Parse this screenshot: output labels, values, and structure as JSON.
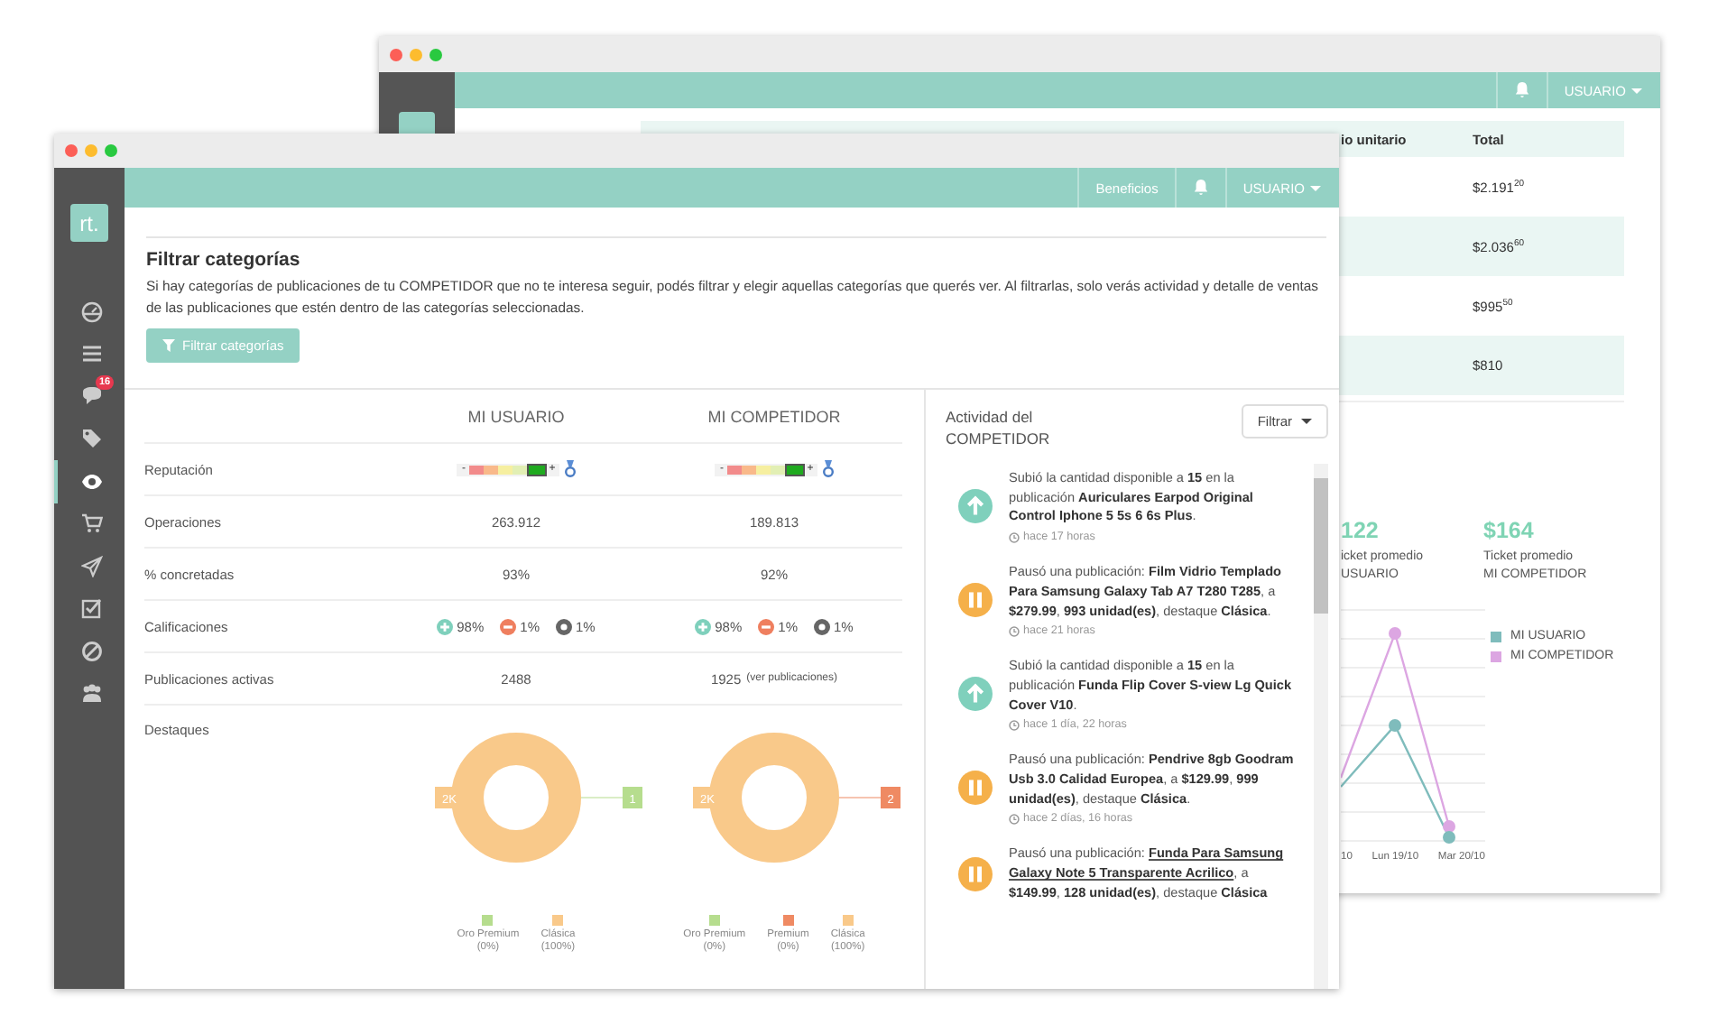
{
  "back_window": {
    "header": {
      "user_menu": "USUARIO"
    },
    "table": {
      "columns": [
        "io unitario",
        "Total"
      ],
      "rows": [
        {
          "total": "$2.191$^{20}$"
        },
        {
          "total": "$2.036$^{60}$"
        },
        {
          "total": "$995$^{50}$"
        },
        {
          "total": "$810"
        }
      ]
    },
    "stats": [
      {
        "value": "122",
        "label": "icket promedio",
        "owner": "USUARIO"
      },
      {
        "value": "$164",
        "label": "Ticket promedio",
        "owner": "MI COMPETIDOR"
      }
    ],
    "chart": {
      "x_labels": [
        "10",
        "Lun 19/10",
        "Mar 20/10"
      ],
      "legend": [
        {
          "label": "MI USUARIO",
          "color": "#7fbcbc"
        },
        {
          "label": "MI COMPETIDOR",
          "color": "#dca6e2"
        }
      ]
    }
  },
  "front_window": {
    "header": {
      "links": [
        "Beneficios"
      ],
      "user_menu": "USUARIO"
    },
    "sidebar": {
      "logo": "rt.",
      "items": [
        {
          "kind": "dashboard",
          "selected": false
        },
        {
          "kind": "list",
          "selected": false
        },
        {
          "kind": "chat",
          "selected": false,
          "badge": "16"
        },
        {
          "kind": "tags",
          "selected": false
        },
        {
          "kind": "eye",
          "selected": true
        },
        {
          "kind": "cart",
          "selected": false
        },
        {
          "kind": "send",
          "selected": false
        },
        {
          "kind": "check",
          "selected": false
        },
        {
          "kind": "ban",
          "selected": false
        },
        {
          "kind": "users",
          "selected": false
        }
      ]
    },
    "filter_section": {
      "title": "Filtrar categorías",
      "description": "Si hay categorías de publicaciones de tu COMPETIDOR que no te interesa seguir, podés filtrar y elegir aquellas categorías que querés ver. Al filtrarlas, solo verás actividad y detalle de ventas de las publicaciones que estén dentro de las categorías seleccionadas.",
      "button": "Filtrar categorías"
    },
    "comparison": {
      "columns": [
        "MI USUARIO",
        "MI COMPETIDOR"
      ],
      "rows": [
        {
          "kind": "reputation",
          "label": "Reputación",
          "values": [
            {
              "min": "-",
              "max": "+",
              "segments": [
                {
                  "color": "#f28b8b",
                  "selected": false
                },
                {
                  "color": "#f9b98a",
                  "selected": false
                },
                {
                  "color": "#f6efa0",
                  "selected": false
                },
                {
                  "color": "#e2efb4",
                  "selected": false
                },
                {
                  "color": "#1faa1f",
                  "selected": true
                }
              ]
            },
            {
              "min": "-",
              "max": "+",
              "segments": [
                {
                  "color": "#f28b8b",
                  "selected": false
                },
                {
                  "color": "#f9b98a",
                  "selected": false
                },
                {
                  "color": "#f6efa0",
                  "selected": false
                },
                {
                  "color": "#e2efb4",
                  "selected": false
                },
                {
                  "color": "#1faa1f",
                  "selected": true
                }
              ]
            }
          ]
        },
        {
          "kind": "text",
          "label": "Operaciones",
          "values": [
            {
              "text": "263.912"
            },
            {
              "text": "189.813"
            }
          ]
        },
        {
          "kind": "text",
          "label": "% concretadas",
          "values": [
            {
              "text": "93%"
            },
            {
              "text": "92%"
            }
          ]
        },
        {
          "kind": "ratings",
          "label": "Calificaciones",
          "values": [
            {
              "ratings": [
                {
                  "kind": "positive",
                  "text": "98%"
                },
                {
                  "kind": "negative",
                  "text": "1%"
                },
                {
                  "kind": "neutral",
                  "text": "1%"
                }
              ]
            },
            {
              "ratings": [
                {
                  "kind": "positive",
                  "text": "98%"
                },
                {
                  "kind": "negative",
                  "text": "1%"
                },
                {
                  "kind": "neutral",
                  "text": "1%"
                }
              ]
            }
          ]
        },
        {
          "kind": "text",
          "label": "Publicaciones activas",
          "values": [
            {
              "text": "2488"
            },
            {
              "text": "1925",
              "link": "(ver publicaciones)"
            }
          ]
        },
        {
          "kind": "highlights",
          "label": "Destaques",
          "values": [
            {
              "callouts": [
                {
                  "text": "2K",
                  "color": "#f9c98a"
                },
                {
                  "text": "1",
                  "color": "#b6dd8e"
                }
              ],
              "legend": [
                {
                  "label": "Oro Premium",
                  "share": "(0%)",
                  "color": "#b6dd8e"
                },
                {
                  "label": "Clásica",
                  "share": "(100%)",
                  "color": "#f9c98a"
                }
              ]
            },
            {
              "callouts": [
                {
                  "text": "2K",
                  "color": "#f9c98a"
                },
                {
                  "text": "2",
                  "color": "#ef8a63"
                }
              ],
              "legend": [
                {
                  "label": "Oro Premium",
                  "share": "(0%)",
                  "color": "#b6dd8e"
                },
                {
                  "label": "Premium",
                  "share": "(0%)",
                  "color": "#ef8a63"
                },
                {
                  "label": "Clásica",
                  "share": "(100%)",
                  "color": "#f9c98a"
                }
              ]
            }
          ]
        }
      ]
    },
    "activity": {
      "title": "Actividad del COMPETIDOR",
      "filter_button": "Filtrar",
      "items": [
        {
          "kind": "up",
          "text": "Subió la cantidad disponible a **15** en la publicación **Auriculares Earpod Original Control Iphone 5 5s 6 6s Plus**.",
          "time": "hace 17 horas"
        },
        {
          "kind": "pause",
          "text": "Pausó una publicación: **Film Vidrio Templado Para Samsung Galaxy Tab A7 T280 T285**, a **$279.99**, **993 unidad(es)**, destaque **Clásica**.",
          "time": "hace 21 horas"
        },
        {
          "kind": "up",
          "text": "Subió la cantidad disponible a **15** en la publicación **Funda Flip Cover S-view Lg Quick Cover V10**.",
          "time": "hace 1 día, 22 horas"
        },
        {
          "kind": "pause",
          "text": "Pausó una publicación: **Pendrive 8gb Goodram Usb 3.0 Calidad Europea**, a **$129.99**, **999 unidad(es)**, destaque **Clásica**.",
          "time": "hace 2 días, 16 horas"
        },
        {
          "kind": "pause",
          "text": "Pausó una publicación: ",
          "link": "Funda Para Samsung Galaxy Note 5 Transparente Acrilico",
          "rest": ", a **$149.99**, **128 unidad(es)**, destaque **Clásica**"
        }
      ]
    }
  }
}
